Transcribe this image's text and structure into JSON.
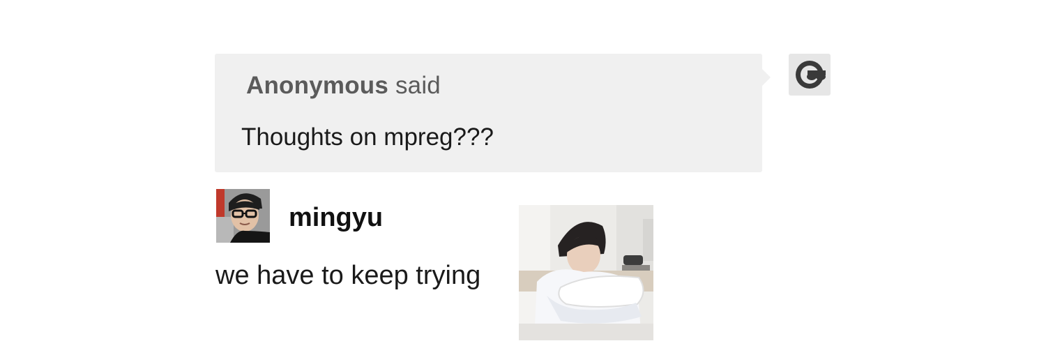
{
  "ask": {
    "asker_name": "Anonymous",
    "asker_verb": "said",
    "question": "Thoughts on mpreg???",
    "avatar_icon": "sunglasses-anon-icon"
  },
  "answer": {
    "username": "mingyu",
    "text": "we have to keep trying",
    "avatar_icon": "user-photo",
    "photo_icon": "pillow-photo"
  },
  "colors": {
    "ask_bg": "#f0f0f0",
    "asker_text": "#5b5b5b",
    "body_text": "#1a1a1a"
  }
}
